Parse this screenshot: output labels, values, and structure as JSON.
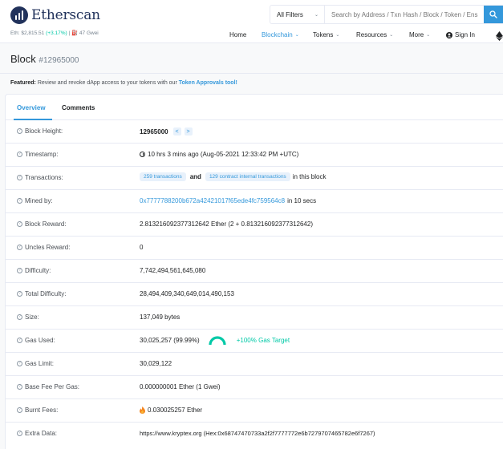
{
  "header": {
    "brand": "Etherscan",
    "eth_price_label": "Eth: $2,815.51",
    "eth_price_change": "(+3.17%)",
    "separator": "|",
    "gas": "47 Gwei",
    "search": {
      "filter_label": "All Filters",
      "placeholder": "Search by Address / Txn Hash / Block / Token / Ens"
    },
    "nav": {
      "home": "Home",
      "blockchain": "Blockchain",
      "tokens": "Tokens",
      "resources": "Resources",
      "more": "More",
      "sign_in": "Sign In"
    }
  },
  "page": {
    "title": "Block",
    "block_ref": "#12965000",
    "featured": {
      "prefix": "Featured:",
      "text": "Review and revoke dApp access to your tokens with our",
      "link": "Token Approvals tool!"
    }
  },
  "tabs": {
    "overview": "Overview",
    "comments": "Comments"
  },
  "details": {
    "block_height": {
      "label": "Block Height:",
      "value": "12965000",
      "prev": "<",
      "next": ">"
    },
    "timestamp": {
      "label": "Timestamp:",
      "value": "10 hrs 3 mins ago (Aug-05-2021 12:33:42 PM +UTC)"
    },
    "transactions": {
      "label": "Transactions:",
      "txns": "259 transactions",
      "and": "and",
      "internal": "129 contract internal transactions",
      "suffix": "in this block"
    },
    "mined_by": {
      "label": "Mined by:",
      "address": "0x7777788200b672a42421017f65ede4fc759564c8",
      "suffix": "in 10 secs"
    },
    "block_reward": {
      "label": "Block Reward:",
      "value": "2.813216092377312642 Ether (2 + 0.813216092377312642)"
    },
    "uncles_reward": {
      "label": "Uncles Reward:",
      "value": "0"
    },
    "difficulty": {
      "label": "Difficulty:",
      "value": "7,742,494,561,645,080"
    },
    "total_difficulty": {
      "label": "Total Difficulty:",
      "value": "28,494,409,340,649,014,490,153"
    },
    "size": {
      "label": "Size:",
      "value": "137,049 bytes"
    },
    "gas_used": {
      "label": "Gas Used:",
      "value": "30,025,257 (99.99%)",
      "target": "+100% Gas Target"
    },
    "gas_limit": {
      "label": "Gas Limit:",
      "value": "30,029,122"
    },
    "base_fee": {
      "label": "Base Fee Per Gas:",
      "value": "0.000000001 Ether (1 Gwei)"
    },
    "burnt_fees": {
      "label": "Burnt Fees:",
      "value": "0.030025257 Ether"
    },
    "extra_data": {
      "label": "Extra Data:",
      "value": "https://www.kryptex.org (Hex:0x68747470733a2f2f7777772e6b7279707465782e6f7267)"
    }
  },
  "colors": {
    "accent": "#3498db",
    "success": "#00c9a7",
    "brand": "#21325b"
  }
}
